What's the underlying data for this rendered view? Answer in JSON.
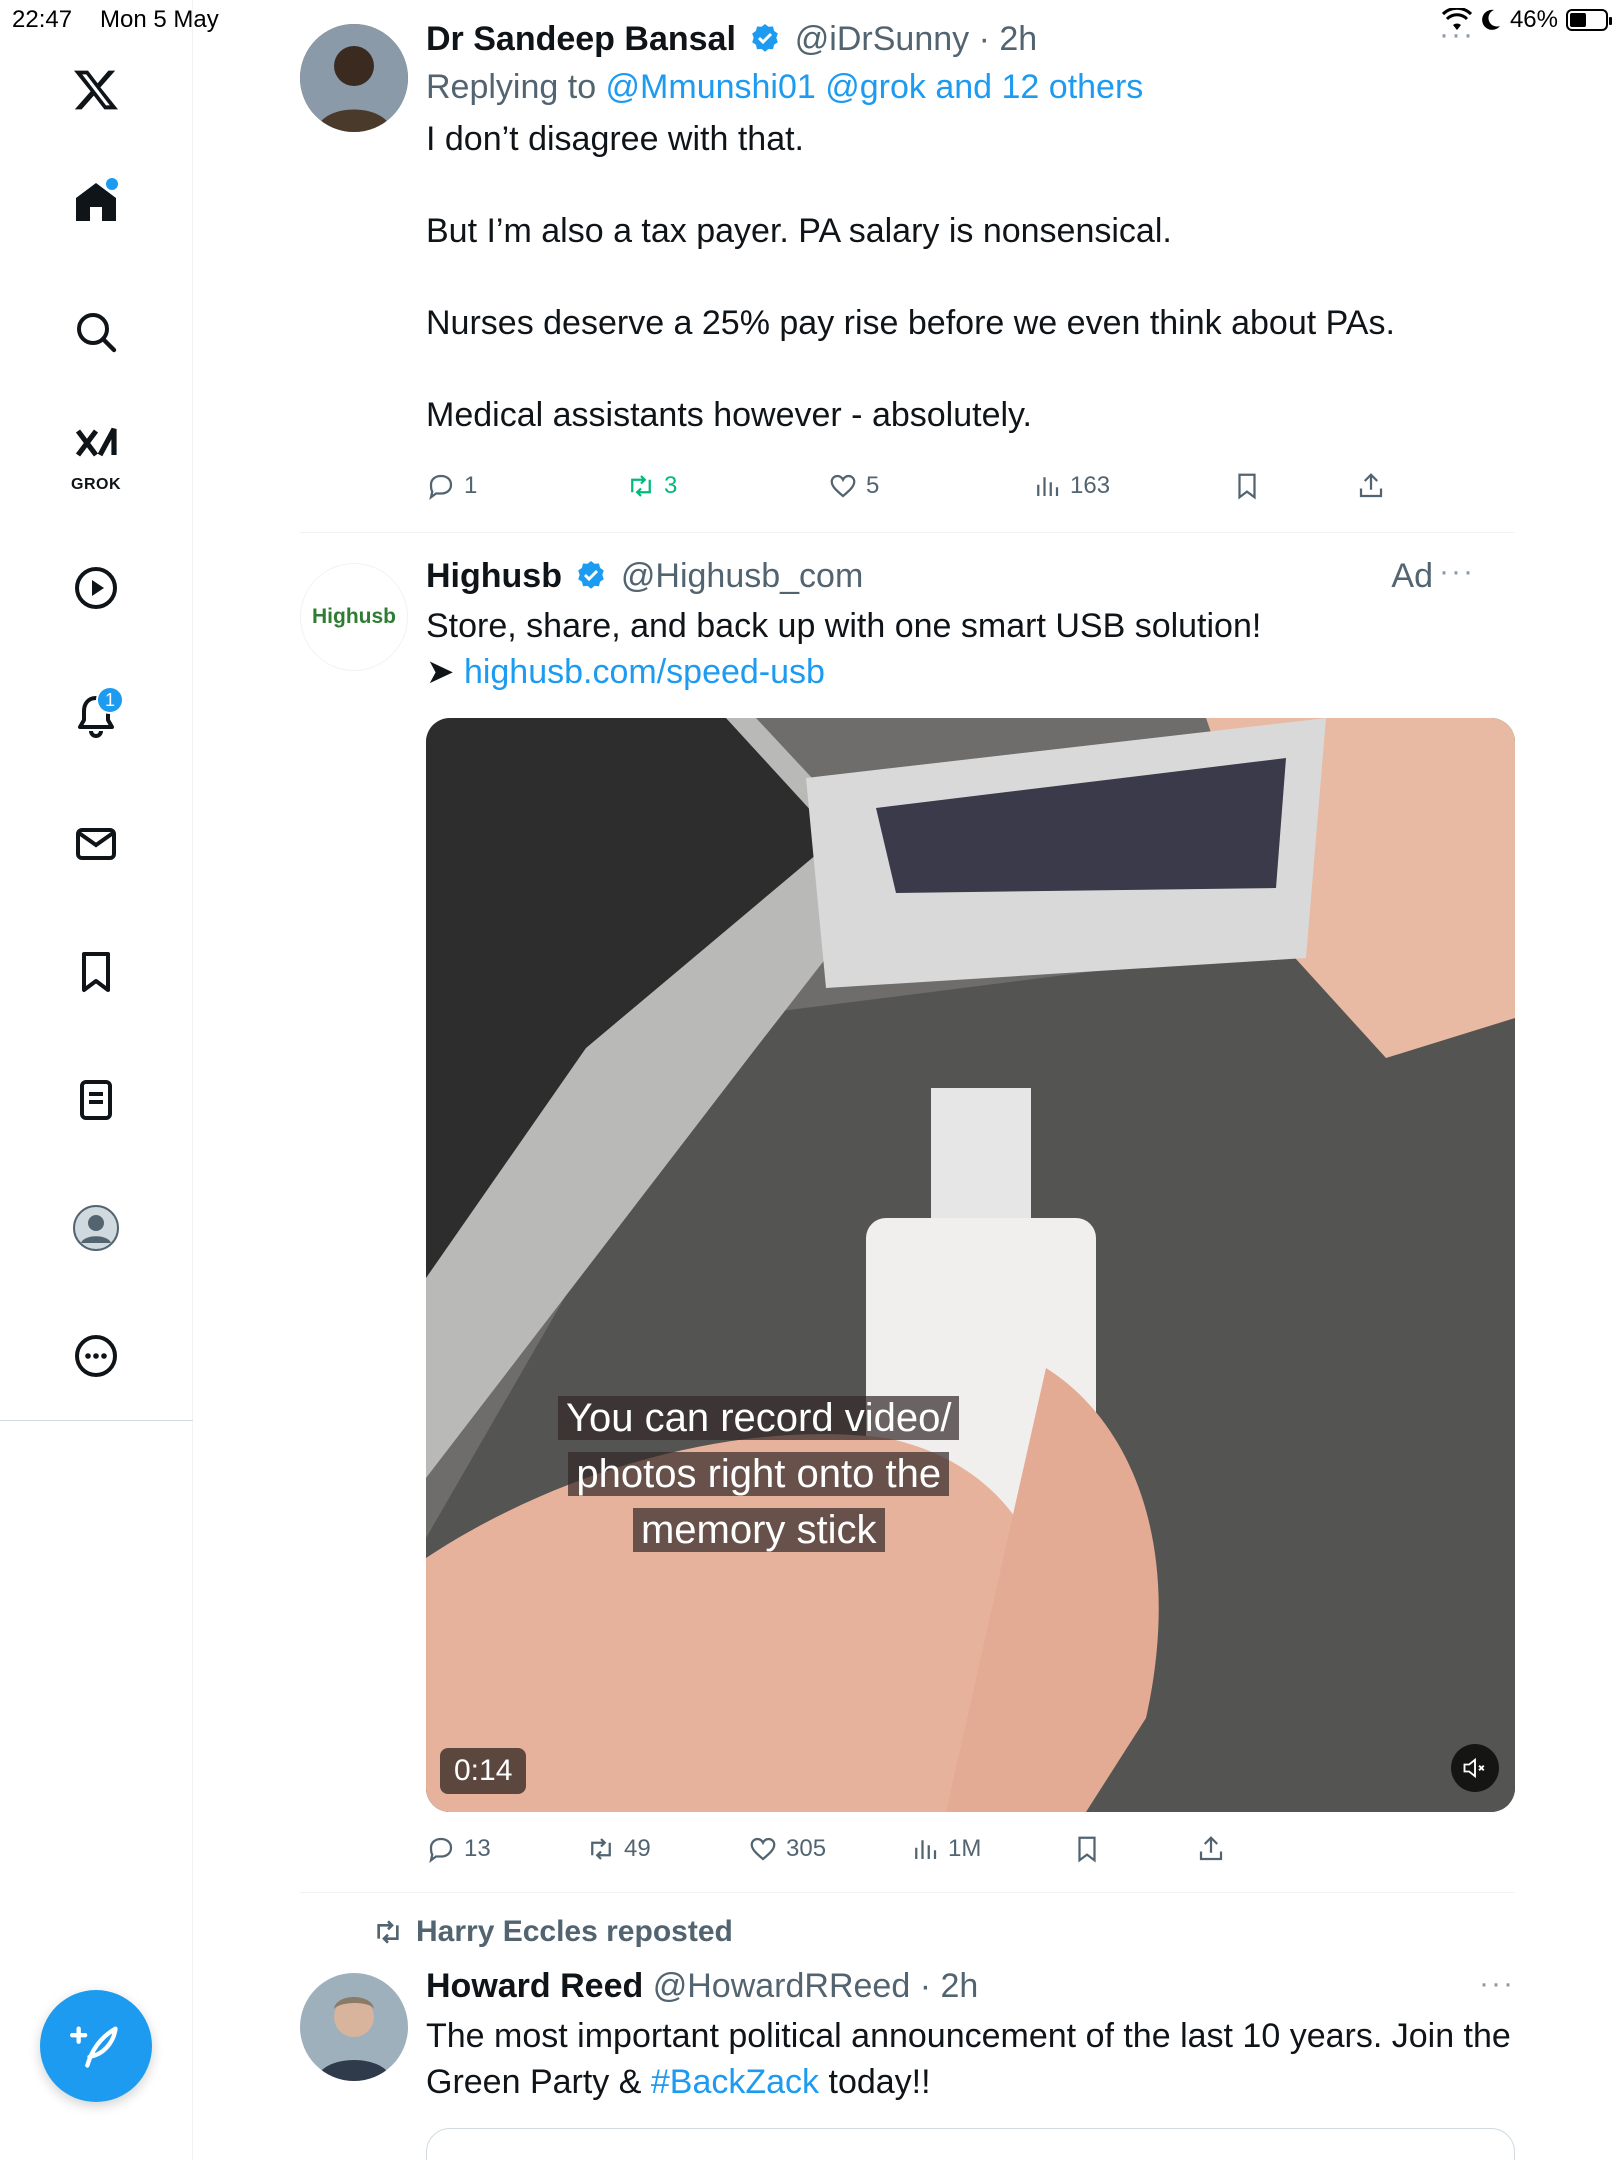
{
  "status_bar": {
    "time": "22:47",
    "date": "Mon 5 May",
    "battery": "46%",
    "battery_level": 0.46
  },
  "sidebar": {
    "grok_label": "GROK",
    "notifications_badge": "1"
  },
  "tweets": [
    {
      "name": "Dr Sandeep Bansal",
      "handle": "@iDrSunny",
      "time": "· 2h",
      "reply_prefix": "Replying to ",
      "reply_users": "@Mmunshi01 @grok and 12 others",
      "paragraphs": [
        "I don’t disagree with that.",
        "But I’m also a tax payer. PA salary is nonsensical.",
        "Nurses deserve a 25% pay rise before we even think about PAs.",
        "Medical assistants however - absolutely."
      ],
      "replies": "1",
      "retweets": "3",
      "likes": "5",
      "views": "163"
    },
    {
      "name": "Highusb",
      "handle": "@Highusb_com",
      "ad_label": "Ad",
      "avatar_text": "Highusb",
      "text": "Store, share, and back up with one smart USB solution!",
      "link_arrow": "➤ ",
      "link": "highusb.com/speed-usb",
      "video_caption_lines": [
        "You can record video/",
        "photos right onto the",
        "memory stick"
      ],
      "video_duration": "0:14",
      "replies": "13",
      "retweets": "49",
      "likes": "305",
      "views": "1M"
    },
    {
      "reposted_by": "Harry Eccles reposted",
      "name": "Howard Reed",
      "handle": "@HowardRReed",
      "time": "· 2h",
      "text_before": "The most important political announcement of the last 10 years. Join the Green Party & ",
      "hashtag": "#BackZack",
      "text_after": " today!!"
    }
  ],
  "colors": {
    "accent": "#1d9bf0",
    "retweet_active": "#00ba7c",
    "secondary_text": "#536471"
  }
}
